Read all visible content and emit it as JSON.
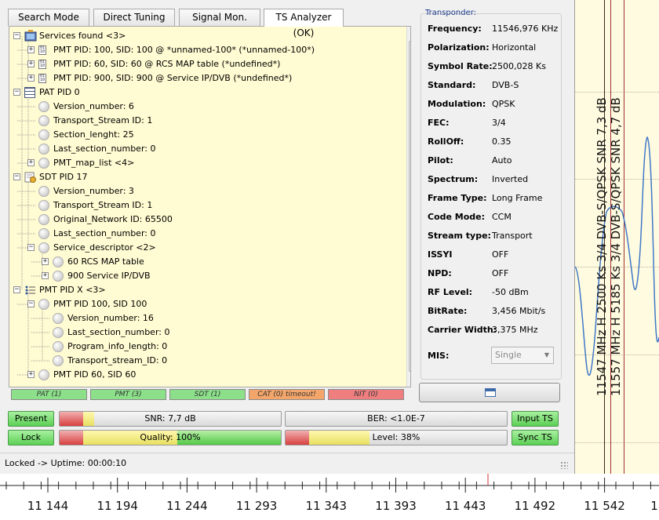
{
  "tabs": [
    {
      "label": "Search Mode"
    },
    {
      "label": "Direct Tuning"
    },
    {
      "label": "Signal Mon."
    },
    {
      "label": "TS Analyzer (OK)"
    }
  ],
  "tree": [
    {
      "label": "Services found <3>"
    },
    {
      "label": "PMT PID: 100, SID: 100 @ *unnamed-100* (*unnamed-100*)"
    },
    {
      "label": "PMT PID: 60, SID: 60 @ RCS MAP table (*undefined*)"
    },
    {
      "label": "PMT PID: 900, SID: 900 @ Service IP/DVB (*undefined*)"
    },
    {
      "label": "PAT PID 0"
    },
    {
      "label": "Version_number: 6"
    },
    {
      "label": "Transport_Stream ID: 1"
    },
    {
      "label": "Section_lenght: 25"
    },
    {
      "label": "Last_section_number: 0"
    },
    {
      "label": "PMT_map_list <4>"
    },
    {
      "label": "SDT PID 17"
    },
    {
      "label": "Version_number: 3"
    },
    {
      "label": "Transport_Stream ID: 1"
    },
    {
      "label": "Original_Network ID: 65500"
    },
    {
      "label": "Last_section_number: 0"
    },
    {
      "label": "Service_descriptor <2>"
    },
    {
      "label": "60 RCS MAP table"
    },
    {
      "label": "900 Service IP/DVB"
    },
    {
      "label": "PMT PID X <3>"
    },
    {
      "label": "PMT PID 100, SID 100"
    },
    {
      "label": "Version_number: 16"
    },
    {
      "label": "Last_section_number: 0"
    },
    {
      "label": "Program_info_length: 0"
    },
    {
      "label": "Transport_stream_ID: 0"
    },
    {
      "label": "PMT PID 60, SID 60"
    }
  ],
  "table_status": [
    {
      "label": "PAT (1)",
      "color": "#8ce08a"
    },
    {
      "label": "PMT (3)",
      "color": "#8ce08a"
    },
    {
      "label": "SDT (1)",
      "color": "#8ce08a"
    },
    {
      "label": "CAT (0) timeout!",
      "color": "#f4a66a"
    },
    {
      "label": "NIT (0)",
      "color": "#ef7f7f"
    }
  ],
  "transponder": {
    "title": "Transponder:",
    "fields": [
      {
        "label": "Frequency:",
        "value": "11546,976 KHz"
      },
      {
        "label": "Polarization:",
        "value": "Horizontal"
      },
      {
        "label": "Symbol Rate:",
        "value": "2500,028 Ks"
      },
      {
        "label": "Standard:",
        "value": "DVB-S"
      },
      {
        "label": "Modulation:",
        "value": "QPSK"
      },
      {
        "label": "FEC:",
        "value": "3/4"
      },
      {
        "label": "RollOff:",
        "value": "0.35"
      },
      {
        "label": "Pilot:",
        "value": "Auto"
      },
      {
        "label": "Spectrum:",
        "value": "Inverted"
      },
      {
        "label": "Frame Type:",
        "value": "Long Frame"
      },
      {
        "label": "Code Mode:",
        "value": "CCM"
      },
      {
        "label": "Stream type:",
        "value": "Transport"
      },
      {
        "label": "ISSYI",
        "value": "OFF"
      },
      {
        "label": "NPD:",
        "value": "OFF"
      },
      {
        "label": "RF Level:",
        "value": "-50 dBm"
      },
      {
        "label": "BitRate:",
        "value": "3,456 Mbit/s"
      },
      {
        "label": "Carrier Width:",
        "value": "3,375 MHz"
      }
    ],
    "mis_label": "MIS:",
    "mis_value": "Single"
  },
  "indicators": {
    "present_label": "Present",
    "lock_label": "Lock",
    "input_ts_label": "Input TS",
    "sync_ts_label": "Sync TS",
    "snr_text": "SNR: 7,7 dB",
    "ber_text": "BER: <1.0E-7",
    "quality_text": "Quality: 100%",
    "level_text": "Level: 38%",
    "quality_fraction": 1.0,
    "level_fraction": 0.38
  },
  "status_bar": {
    "text": "Locked -> Uptime: 00:00:10"
  },
  "spectrum": {
    "axis_labels": [
      "11 144",
      "11 194",
      "11 244",
      "11 293",
      "11 343",
      "11 393",
      "11 443",
      "11 492",
      "11 542",
      "1"
    ],
    "carrier_labels": [
      "11547 MHz H 2500 Ks 3/4 DVB-S/QPSK SNR 7,3 dB",
      "11557 MHz H 5185 Ks 3/4 DVB-S/QPSK SNR 4,7 dB"
    ]
  }
}
